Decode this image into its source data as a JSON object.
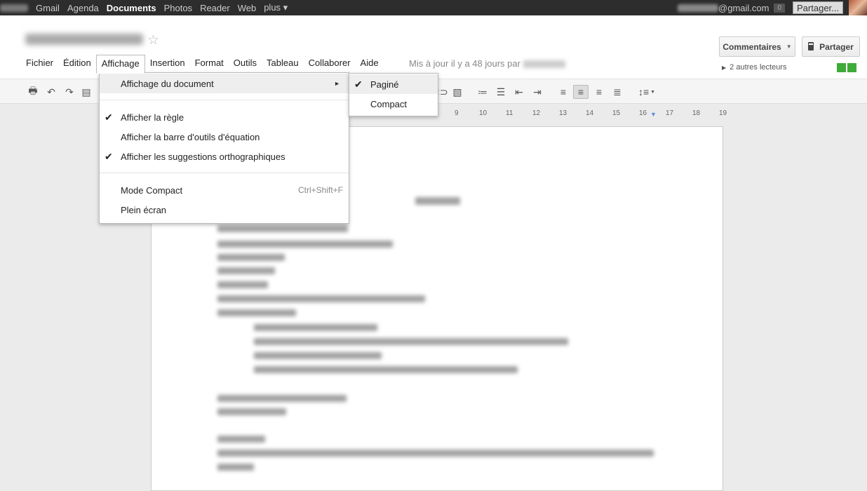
{
  "gbar": {
    "links": [
      "Gmail",
      "Agenda",
      "Documents",
      "Photos",
      "Reader",
      "Web",
      "plus ▾"
    ],
    "current": "Documents",
    "email_suffix": "@gmail.com",
    "notif_count": "0",
    "share_label": "Partager..."
  },
  "header": {
    "updated_text": "Mis à jour il y a 48 jours par",
    "comments_label": "Commentaires",
    "share_label": "Partager",
    "viewers_text": "2 autres lecteurs"
  },
  "menubar": [
    "Fichier",
    "Édition",
    "Affichage",
    "Insertion",
    "Format",
    "Outils",
    "Tableau",
    "Collaborer",
    "Aide"
  ],
  "menu_affichage": {
    "doc_view": "Affichage du document",
    "show_ruler": "Afficher la règle",
    "show_equation": "Afficher la barre d'outils d'équation",
    "show_spelling": "Afficher les suggestions orthographiques",
    "compact_mode": "Mode Compact",
    "compact_shortcut": "Ctrl+Shift+F",
    "fullscreen": "Plein écran"
  },
  "submenu": {
    "paged": "Paginé",
    "compact": "Compact"
  },
  "ruler_ticks": [
    "9",
    "10",
    "11",
    "12",
    "13",
    "14",
    "15",
    "16",
    "17",
    "18",
    "19"
  ],
  "icons": {
    "check": "✔",
    "star": "☆",
    "lock": "🔒",
    "submenu_arrow": "►"
  }
}
